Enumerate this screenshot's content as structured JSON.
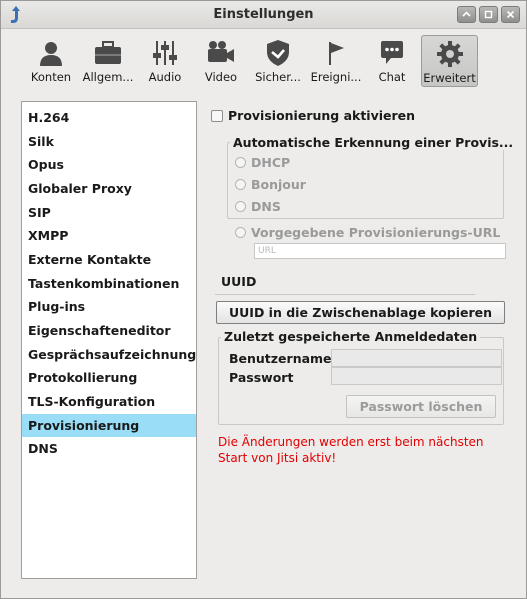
{
  "window": {
    "title": "Einstellungen",
    "controls": [
      "up",
      "restore",
      "close"
    ]
  },
  "toolbar": {
    "items": [
      {
        "label": "Konten",
        "icon": "person-icon"
      },
      {
        "label": "Allgem...",
        "icon": "briefcase-icon"
      },
      {
        "label": "Audio",
        "icon": "sliders-icon"
      },
      {
        "label": "Video",
        "icon": "video-camera-icon"
      },
      {
        "label": "Sicher...",
        "icon": "shield-icon"
      },
      {
        "label": "Ereigni...",
        "icon": "flag-icon"
      },
      {
        "label": "Chat",
        "icon": "chat-bubble-icon"
      },
      {
        "label": "Erweitert",
        "icon": "gear-icon"
      }
    ],
    "selected": "Erweitert"
  },
  "sidebar": {
    "items": [
      "H.264",
      "Silk",
      "Opus",
      "Globaler Proxy",
      "SIP",
      "XMPP",
      "Externe Kontakte",
      "Tastenkombinationen",
      "Plug-ins",
      "Eigenschafteneditor",
      "Gesprächsaufzeichnung",
      "Protokollierung",
      "TLS-Konfiguration",
      "Provisionierung",
      "DNS"
    ],
    "selected": "Provisionierung"
  },
  "provisioning": {
    "enable_label": "Provisionierung aktivieren",
    "enabled": false,
    "autodetect_legend": "Automatische Erkennung einer Provis...",
    "options": [
      "DHCP",
      "Bonjour",
      "DNS"
    ],
    "manual_url_label": "Vorgegebene Provisionierungs-URL",
    "url_placeholder": "URL"
  },
  "uuid": {
    "heading": "UUID",
    "copy_button": "UUID in die Zwischenablage kopieren"
  },
  "credentials": {
    "legend": "Zuletzt gespeicherte Anmeldedaten",
    "username_label": "Benutzername",
    "password_label": "Passwort",
    "username_value": "",
    "password_value": "",
    "delete_password_button": "Passwort löschen"
  },
  "notice": {
    "line1": "Die Änderungen werden erst beim nächsten",
    "line2": "Start von Jitsi aktiv!",
    "color": "#e10000"
  },
  "colors": {
    "selection": "#99def6",
    "window_bg": "#edecea"
  }
}
